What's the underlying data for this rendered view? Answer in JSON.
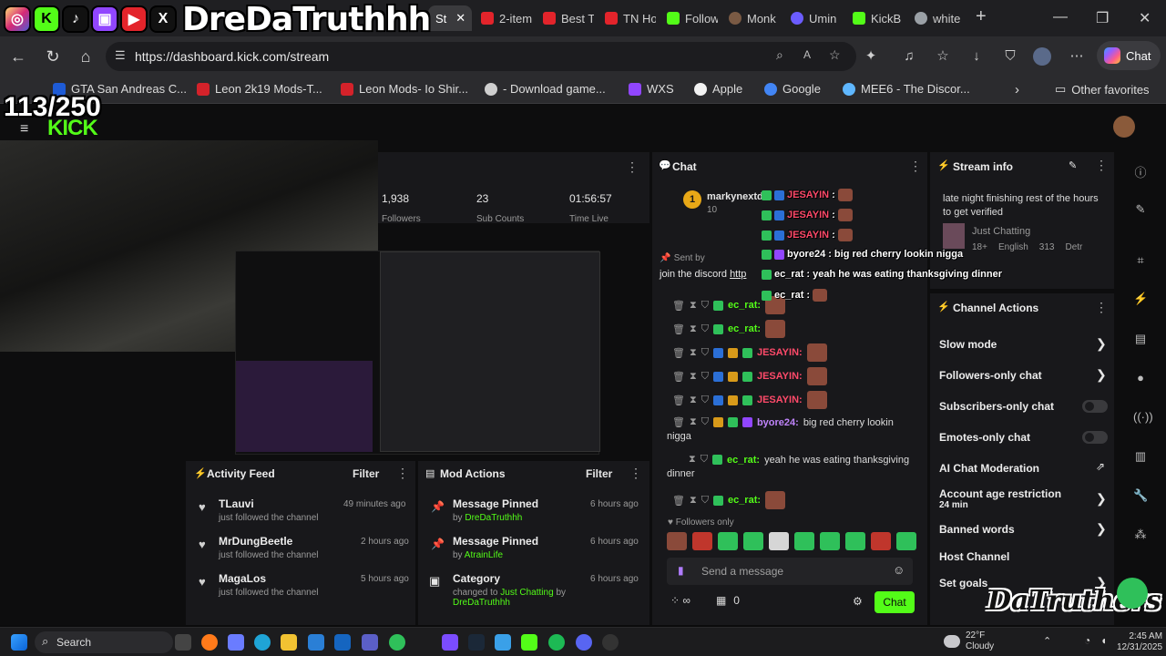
{
  "overlay": {
    "handle": "DreDaTruthhh",
    "social_icons": [
      "instagram-icon",
      "kick-icon",
      "tiktok-icon",
      "twitch-icon",
      "youtube-icon",
      "x-icon"
    ],
    "follower_goal": "113/250",
    "watermark": "DaTruthers",
    "chat_overlay": [
      {
        "user": "JESAYIN",
        "text": ":"
      },
      {
        "user": "JESAYIN",
        "text": ":"
      },
      {
        "user": "JESAYIN",
        "text": ":"
      },
      {
        "user": "byore24",
        "text": ": big red cherry lookin nigga"
      },
      {
        "user": "ec_rat",
        "text": ": yeah he was eating thanksgiving dinner"
      },
      {
        "user": "ec_rat",
        "text": ":"
      }
    ]
  },
  "browser": {
    "tabs": [
      {
        "label": "St",
        "active": true
      },
      {
        "label": "2-item"
      },
      {
        "label": "Best T"
      },
      {
        "label": "TN Ho"
      },
      {
        "label": "Follow"
      },
      {
        "label": "Monk"
      },
      {
        "label": "Umin"
      },
      {
        "label": "KickB"
      },
      {
        "label": "white"
      }
    ],
    "new_tab": "+",
    "url": "https://dashboard.kick.com/stream",
    "copilot_label": "Chat",
    "bookmarks": [
      "GTA San Andreas C...",
      "Leon 2k19 Mods-T...",
      "Leon Mods- Io Shir...",
      "- Download game...",
      "WXS",
      "Apple",
      "Google",
      "MEE6 - The Discor..."
    ],
    "other_favorites": "Other favorites"
  },
  "dashboard": {
    "stats": [
      {
        "value": "1,938",
        "label": "Followers"
      },
      {
        "value": "23",
        "label": "Sub Counts"
      },
      {
        "value": "01:56:57",
        "label": "Time Live"
      }
    ],
    "activity_feed": {
      "title": "Activity Feed",
      "filter": "Filter",
      "items": [
        {
          "name": "TLauvi",
          "action": "just followed the channel",
          "time": "49 minutes ago"
        },
        {
          "name": "MrDungBeetle",
          "action": "just followed the channel",
          "time": "2 hours ago"
        },
        {
          "name": "MagaLos",
          "action": "just followed the channel",
          "time": "5 hours ago"
        }
      ]
    },
    "mod_actions": {
      "title": "Mod Actions",
      "filter": "Filter",
      "items": [
        {
          "title": "Message Pinned",
          "by": "by",
          "user": "DreDaTruthhh",
          "time": "6 hours ago"
        },
        {
          "title": "Message Pinned",
          "by": "by",
          "user": "AtrainLife",
          "time": "6 hours ago"
        },
        {
          "title": "Category",
          "detail": "changed to",
          "value": "Just Chatting",
          "by": "by",
          "user": "DreDaTruthhh",
          "time": "6 hours ago"
        }
      ]
    },
    "chat": {
      "title": "Chat",
      "top_user": "markynextdo",
      "top_count": "10",
      "pinned_prefix": "Sent by",
      "pinned_text": "join the discord",
      "pinned_link": "http",
      "messages": [
        {
          "user": "ec_rat:",
          "text": ""
        },
        {
          "user": "ec_rat:",
          "text": ""
        },
        {
          "user": "JESAYIN:",
          "text": ""
        },
        {
          "user": "JESAYIN:",
          "text": ""
        },
        {
          "user": "JESAYIN:",
          "text": ""
        },
        {
          "user": "byore24:",
          "text": "big red cherry lookin",
          "cont": "nigga"
        },
        {
          "user": "ec_rat:",
          "text": "yeah he was eating thanksgiving",
          "cont": "dinner"
        },
        {
          "user": "ec_rat:",
          "text": ""
        }
      ],
      "followers_only": "Followers only",
      "input_placeholder": "Send a message",
      "viewer_count": "0",
      "send": "Chat"
    },
    "stream_info": {
      "title": "Stream info",
      "stream_title": "late night finishing rest of the hours to get verified",
      "category": "Just Chatting",
      "tags": [
        "18+",
        "English",
        "313",
        "Detr"
      ]
    },
    "channel_actions": {
      "title": "Channel Actions",
      "items": [
        {
          "label": "Slow mode",
          "control": "chevron"
        },
        {
          "label": "Followers-only chat",
          "control": "chevron"
        },
        {
          "label": "Subscribers-only chat",
          "control": "toggle"
        },
        {
          "label": "Emotes-only chat",
          "control": "toggle"
        },
        {
          "label": "AI Chat Moderation",
          "control": "external"
        },
        {
          "label": "Account age restriction",
          "sub": "24 min",
          "control": "chevron"
        },
        {
          "label": "Banned words",
          "control": "chevron"
        },
        {
          "label": "Host Channel",
          "control": "none"
        },
        {
          "label": "Set goals",
          "control": "chevron"
        }
      ]
    }
  },
  "taskbar": {
    "search": "Search",
    "weather_temp": "22°F",
    "weather_desc": "Cloudy",
    "time": "2:45 AM",
    "date": "12/31/2025"
  }
}
